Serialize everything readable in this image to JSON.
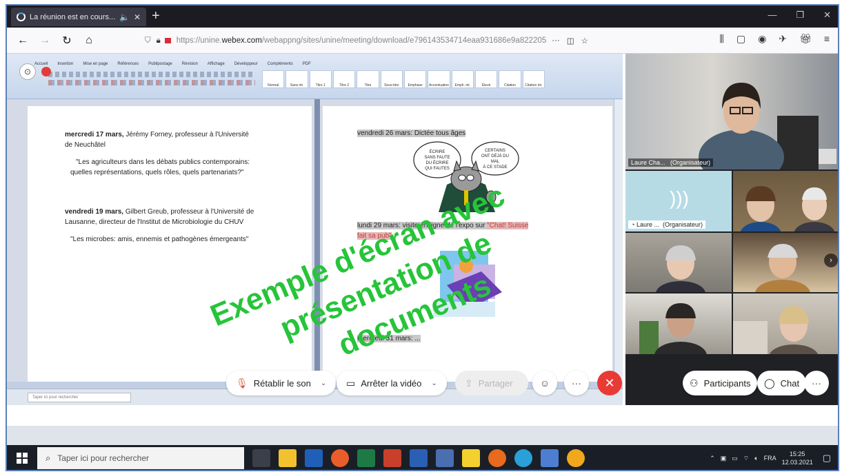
{
  "browser": {
    "tab_title": "La réunion est en cours...",
    "tab_audio_icon": "speaker-icon",
    "tab_close": "✕",
    "new_tab": "+",
    "url_prefix": "https://unine.",
    "url_domain": "webex.com",
    "url_rest": "/webappng/sites/unine/meeting/download/e796143534714eaa931686e9a822205",
    "more_label": "···"
  },
  "document": {
    "left": {
      "event1_date": "mercredi 17 mars,",
      "event1_speaker_line1": " Jérémy Forney, professeur à l'Université",
      "event1_speaker_line2": "de Neuchâtel",
      "event1_title_line1": "\"Les agriculteurs dans les débats publics contemporains:",
      "event1_title_line2": "quelles représentations, quels rôles, quels partenariats?\"",
      "event2_date": "vendredi 19 mars,",
      "event2_speaker_line1": " Gilbert Greub, professeur à l'Université de",
      "event2_speaker_line2": "Lausanne, directeur de l'Institut de Microbiologie du CHUV",
      "event2_title": "\"Les microbes: amis, ennemis et pathogènes émergeants\""
    },
    "right": {
      "item1": "vendredi 26 mars: Dictée tous âges",
      "item2_prefix": "lundi 29 mars: visite en ligne de l'expo sur ",
      "item2_highlight": "\"Chat! Suisse",
      "item2_line2": "fait sa pub\"",
      "item3": "mercredi 31 mars: ...",
      "cartoon_bubble_left": "ÉCRIRE SANS FAUTE DU ÉCRIRE QUI FAUTES",
      "cartoon_bubble_right": "CERTAINS ONT DÉJÀ DU MAL À CE STADE"
    }
  },
  "watermark": {
    "line1": "Exemple d'écran avec",
    "line2": "présentation de",
    "line3": "documents"
  },
  "participants": [
    {
      "name": "Laure Cha...",
      "role": "(Organisateur)"
    },
    {
      "name": "Laure ...",
      "role": "(Organisateur)"
    }
  ],
  "controls": {
    "unmute": "Rétablir le son",
    "stop_video": "Arrêter la vidéo",
    "share": "Partager",
    "participants": "Participants",
    "chat": "Chat",
    "more": "···",
    "end": "✕"
  },
  "taskbar": {
    "search_placeholder": "Taper ici pour rechercher",
    "language": "FRA",
    "time": "15:25",
    "date": "12.03.2021"
  },
  "colors": {
    "watermark": "#27c43a",
    "end_call": "#e83b35",
    "browser_dark": "#1c1b22"
  }
}
